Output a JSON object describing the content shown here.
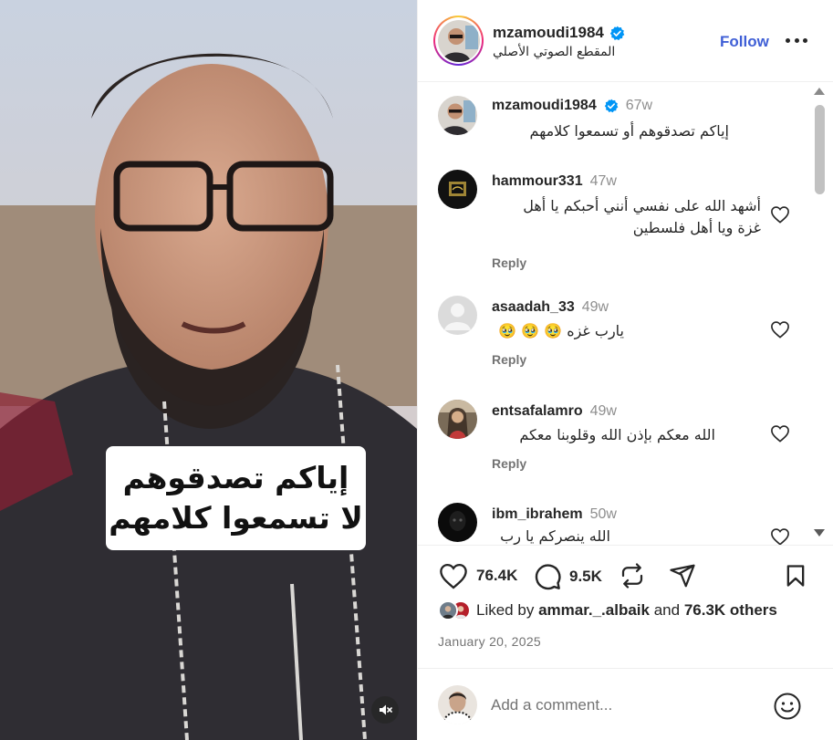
{
  "video": {
    "caption_line1": "إياكم تصدقوهم",
    "caption_line2": "لا تسمعوا كلامهم",
    "mute_icon": "speaker-muted-icon"
  },
  "header": {
    "username": "mzamoudi1984",
    "verified": true,
    "audio_label": "المقطع الصوتي الأصلي",
    "follow_label": "Follow",
    "more_icon": "more-options-icon"
  },
  "caption": {
    "username": "mzamoudi1984",
    "time": "67w",
    "text": "إياكم تصدقوهم أو تسمعوا كلامهم"
  },
  "comments": [
    {
      "username": "hammour331",
      "time": "47w",
      "text_line1": "أشهد الله على نفسي أنني أحبكم يا أهل",
      "text_line2": "غزة ويا أهل فلسطين",
      "reply_label": "Reply"
    },
    {
      "username": "asaadah_33",
      "time": "49w",
      "text_line1": "يارب غزه 🥹 🥹 🥹",
      "reply_label": "Reply"
    },
    {
      "username": "entsafalamro",
      "time": "49w",
      "text_line1": "الله معكم بإذن الله وقلوبنا معكم",
      "reply_label": "Reply"
    },
    {
      "username": "ibm_ibrahem",
      "time": "50w",
      "text_line1": "الله ينصركم يا رب"
    }
  ],
  "actions": {
    "likes_count": "76.4K",
    "comments_count": "9.5K",
    "liked_by_prefix": "Liked by",
    "liked_by_user": "ammar._.albaik",
    "liked_by_and": "and",
    "liked_by_others": "76.3K others",
    "date": "January 20, 2025"
  },
  "add_comment": {
    "placeholder": "Add a comment..."
  },
  "colors": {
    "follow": "#3f5fd6",
    "verified": "#0095f6",
    "muted_text": "#737373"
  }
}
